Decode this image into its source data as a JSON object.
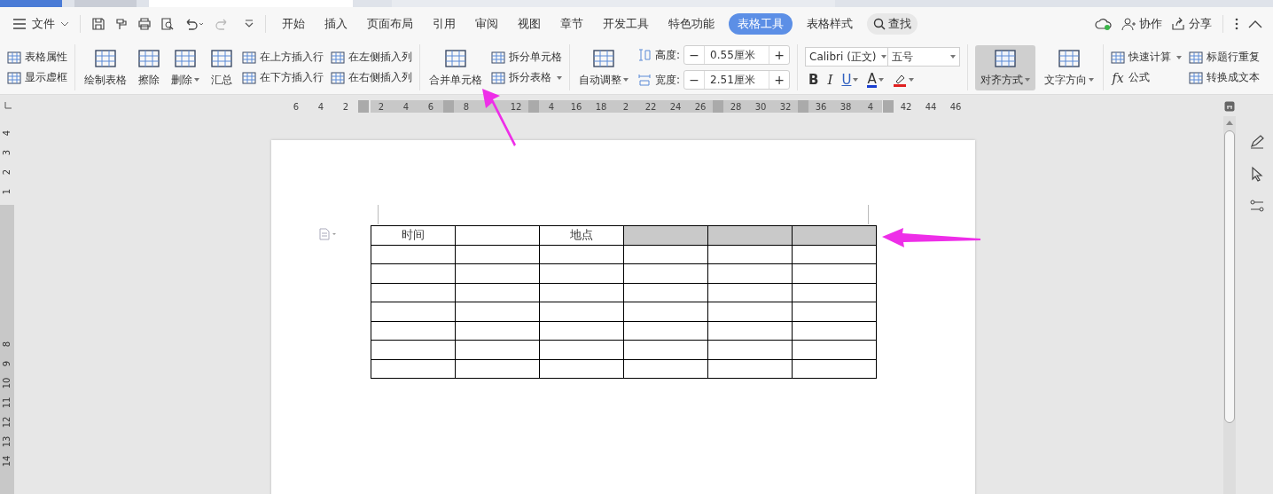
{
  "menu": {
    "file": "文件"
  },
  "tabs": [
    {
      "label": "开始",
      "selected": false
    },
    {
      "label": "插入",
      "selected": false
    },
    {
      "label": "页面布局",
      "selected": false
    },
    {
      "label": "引用",
      "selected": false
    },
    {
      "label": "审阅",
      "selected": false
    },
    {
      "label": "视图",
      "selected": false
    },
    {
      "label": "章节",
      "selected": false
    },
    {
      "label": "开发工具",
      "selected": false
    },
    {
      "label": "特色功能",
      "selected": false
    },
    {
      "label": "表格工具",
      "selected": true
    },
    {
      "label": "表格样式",
      "selected": false
    }
  ],
  "search": {
    "label": "查找"
  },
  "actions": [
    {
      "label": "协作"
    },
    {
      "label": "分享"
    }
  ],
  "ribbon": [
    {
      "columns": [
        {
          "kind": "stack",
          "items": [
            {
              "label": "表格属性",
              "dropdown": false
            },
            {
              "label": "显示虚框",
              "dropdown": false
            }
          ]
        }
      ]
    },
    {
      "columns": [
        {
          "kind": "big",
          "label": "绘制表格",
          "dropdown": false,
          "pressed": false
        },
        {
          "kind": "big",
          "label": "擦除",
          "dropdown": false,
          "pressed": false
        },
        {
          "kind": "big",
          "label": "删除",
          "dropdown": true,
          "pressed": false
        },
        {
          "kind": "big",
          "label": "汇总",
          "dropdown": false,
          "pressed": false
        },
        {
          "kind": "stack",
          "items": [
            {
              "label": "在上方插入行",
              "dropdown": false
            },
            {
              "label": "在下方插入行",
              "dropdown": false
            }
          ]
        },
        {
          "kind": "stack",
          "items": [
            {
              "label": "在左侧插入列",
              "dropdown": false
            },
            {
              "label": "在右侧插入列",
              "dropdown": false
            }
          ]
        }
      ]
    },
    {
      "columns": [
        {
          "kind": "big",
          "label": "合并单元格",
          "dropdown": false,
          "pressed": false
        },
        {
          "kind": "stack",
          "items": [
            {
              "label": "拆分单元格",
              "dropdown": false
            },
            {
              "label": "拆分表格",
              "dropdown": true
            }
          ]
        }
      ]
    },
    {
      "columns": [
        {
          "kind": "big",
          "label": "自动调整",
          "dropdown": true,
          "pressed": false
        },
        {
          "kind": "fields",
          "items": [
            {
              "label": "高度:",
              "value": "0.55厘米",
              "minus": "−",
              "plus": "+"
            },
            {
              "label": "宽度:",
              "value": "2.51厘米",
              "minus": "−",
              "plus": "+"
            }
          ]
        }
      ]
    },
    {
      "columns": [
        {
          "kind": "font",
          "font": "Calibri (正文)",
          "size": "五号",
          "buttons": [
            {
              "kind": "bold",
              "text": "B"
            },
            {
              "kind": "italic",
              "text": "I"
            },
            {
              "kind": "underline",
              "text": "U",
              "dropdown": true
            },
            {
              "kind": "font-color",
              "text": "A",
              "color": "#1a3fd1",
              "dropdown": true
            },
            {
              "kind": "highlight",
              "color": "#e02020",
              "dropdown": true
            }
          ]
        }
      ]
    },
    {
      "columns": [
        {
          "kind": "big",
          "label": "对齐方式",
          "dropdown": true,
          "pressed": true
        },
        {
          "kind": "big",
          "label": "文字方向",
          "dropdown": true,
          "pressed": false
        }
      ]
    },
    {
      "columns": [
        {
          "kind": "stack",
          "items": [
            {
              "label": "快速计算",
              "dropdown": true
            },
            {
              "label": "公式",
              "dropdown": false,
              "glyph": "fx"
            }
          ]
        },
        {
          "kind": "stack",
          "items": [
            {
              "label": "标题行重复",
              "dropdown": false
            },
            {
              "label": "转换成文本",
              "dropdown": false
            }
          ]
        }
      ]
    }
  ],
  "ruler": [
    {
      "text": "6"
    },
    {
      "text": "4"
    },
    {
      "text": "2"
    },
    {
      "kind": "grid"
    },
    {
      "text": "2"
    },
    {
      "text": "4"
    },
    {
      "text": "6"
    },
    {
      "kind": "grid"
    },
    {
      "text": "8"
    },
    {
      "kind": "blank"
    },
    {
      "text": "12"
    },
    {
      "kind": "grid"
    },
    {
      "text": "4"
    },
    {
      "text": "16"
    },
    {
      "text": "18"
    },
    {
      "text": "2"
    },
    {
      "text": "22"
    },
    {
      "text": "24"
    },
    {
      "text": "26"
    },
    {
      "kind": "grid"
    },
    {
      "text": "28"
    },
    {
      "text": "30"
    },
    {
      "text": "32"
    },
    {
      "kind": "grid"
    },
    {
      "text": "36"
    },
    {
      "text": "38"
    },
    {
      "text": "4"
    },
    {
      "kind": "grid"
    },
    {
      "text": "42"
    },
    {
      "text": "44"
    },
    {
      "text": "46"
    }
  ],
  "vruler": [
    "4",
    "3",
    "2",
    "1",
    "8",
    "9",
    "10",
    "11",
    "12",
    "13",
    "14"
  ],
  "table": {
    "rows": [
      {
        "cells": [
          {
            "text": "时间",
            "selected": false
          },
          {
            "selected": false
          },
          {
            "text": "地点",
            "selected": false
          },
          {
            "selected": true
          },
          {
            "selected": true
          },
          {
            "selected": true
          }
        ]
      },
      {
        "cells": [
          {
            "selected": false
          },
          {
            "selected": false
          },
          {
            "selected": false
          },
          {
            "selected": false
          },
          {
            "selected": false
          },
          {
            "selected": false
          }
        ]
      },
      {
        "cells": [
          {
            "selected": false
          },
          {
            "selected": false
          },
          {
            "selected": false
          },
          {
            "selected": false
          },
          {
            "selected": false
          },
          {
            "selected": false
          }
        ]
      },
      {
        "cells": [
          {
            "selected": false
          },
          {
            "selected": false
          },
          {
            "selected": false
          },
          {
            "selected": false
          },
          {
            "selected": false
          },
          {
            "selected": false
          }
        ]
      },
      {
        "cells": [
          {
            "selected": false
          },
          {
            "selected": false
          },
          {
            "selected": false
          },
          {
            "selected": false
          },
          {
            "selected": false
          },
          {
            "selected": false
          }
        ]
      },
      {
        "cells": [
          {
            "selected": false
          },
          {
            "selected": false
          },
          {
            "selected": false
          },
          {
            "selected": false
          },
          {
            "selected": false
          },
          {
            "selected": false
          }
        ]
      },
      {
        "cells": [
          {
            "selected": false
          },
          {
            "selected": false
          },
          {
            "selected": false
          },
          {
            "selected": false
          },
          {
            "selected": false
          },
          {
            "selected": false
          }
        ]
      },
      {
        "cells": [
          {
            "selected": false
          },
          {
            "selected": false
          },
          {
            "selected": false
          },
          {
            "selected": false
          },
          {
            "selected": false
          },
          {
            "selected": false
          }
        ]
      }
    ]
  }
}
